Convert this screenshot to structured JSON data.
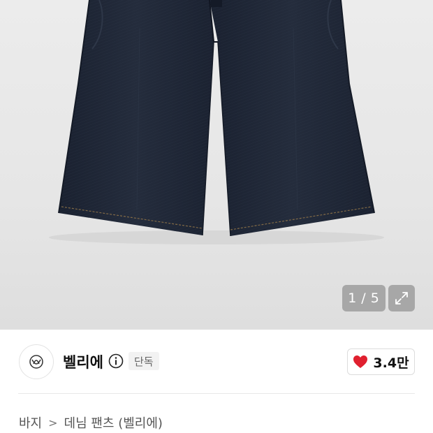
{
  "gallery": {
    "current": "1",
    "separator": "/",
    "total": "5"
  },
  "brand": {
    "name": "벨리에",
    "badge": "단독"
  },
  "like": {
    "count": "3.4만",
    "color": "#e0202f"
  },
  "breadcrumb": {
    "category": "바지",
    "separator": ">",
    "subcategory": "데님 팬츠 (벨리에)"
  },
  "icons": {
    "expand": "expand-icon",
    "info": "info-icon",
    "heart": "heart-icon",
    "logo": "brand-logo-icon"
  },
  "colors": {
    "denim": "#1e2533",
    "stitch": "#9a7a4a"
  }
}
